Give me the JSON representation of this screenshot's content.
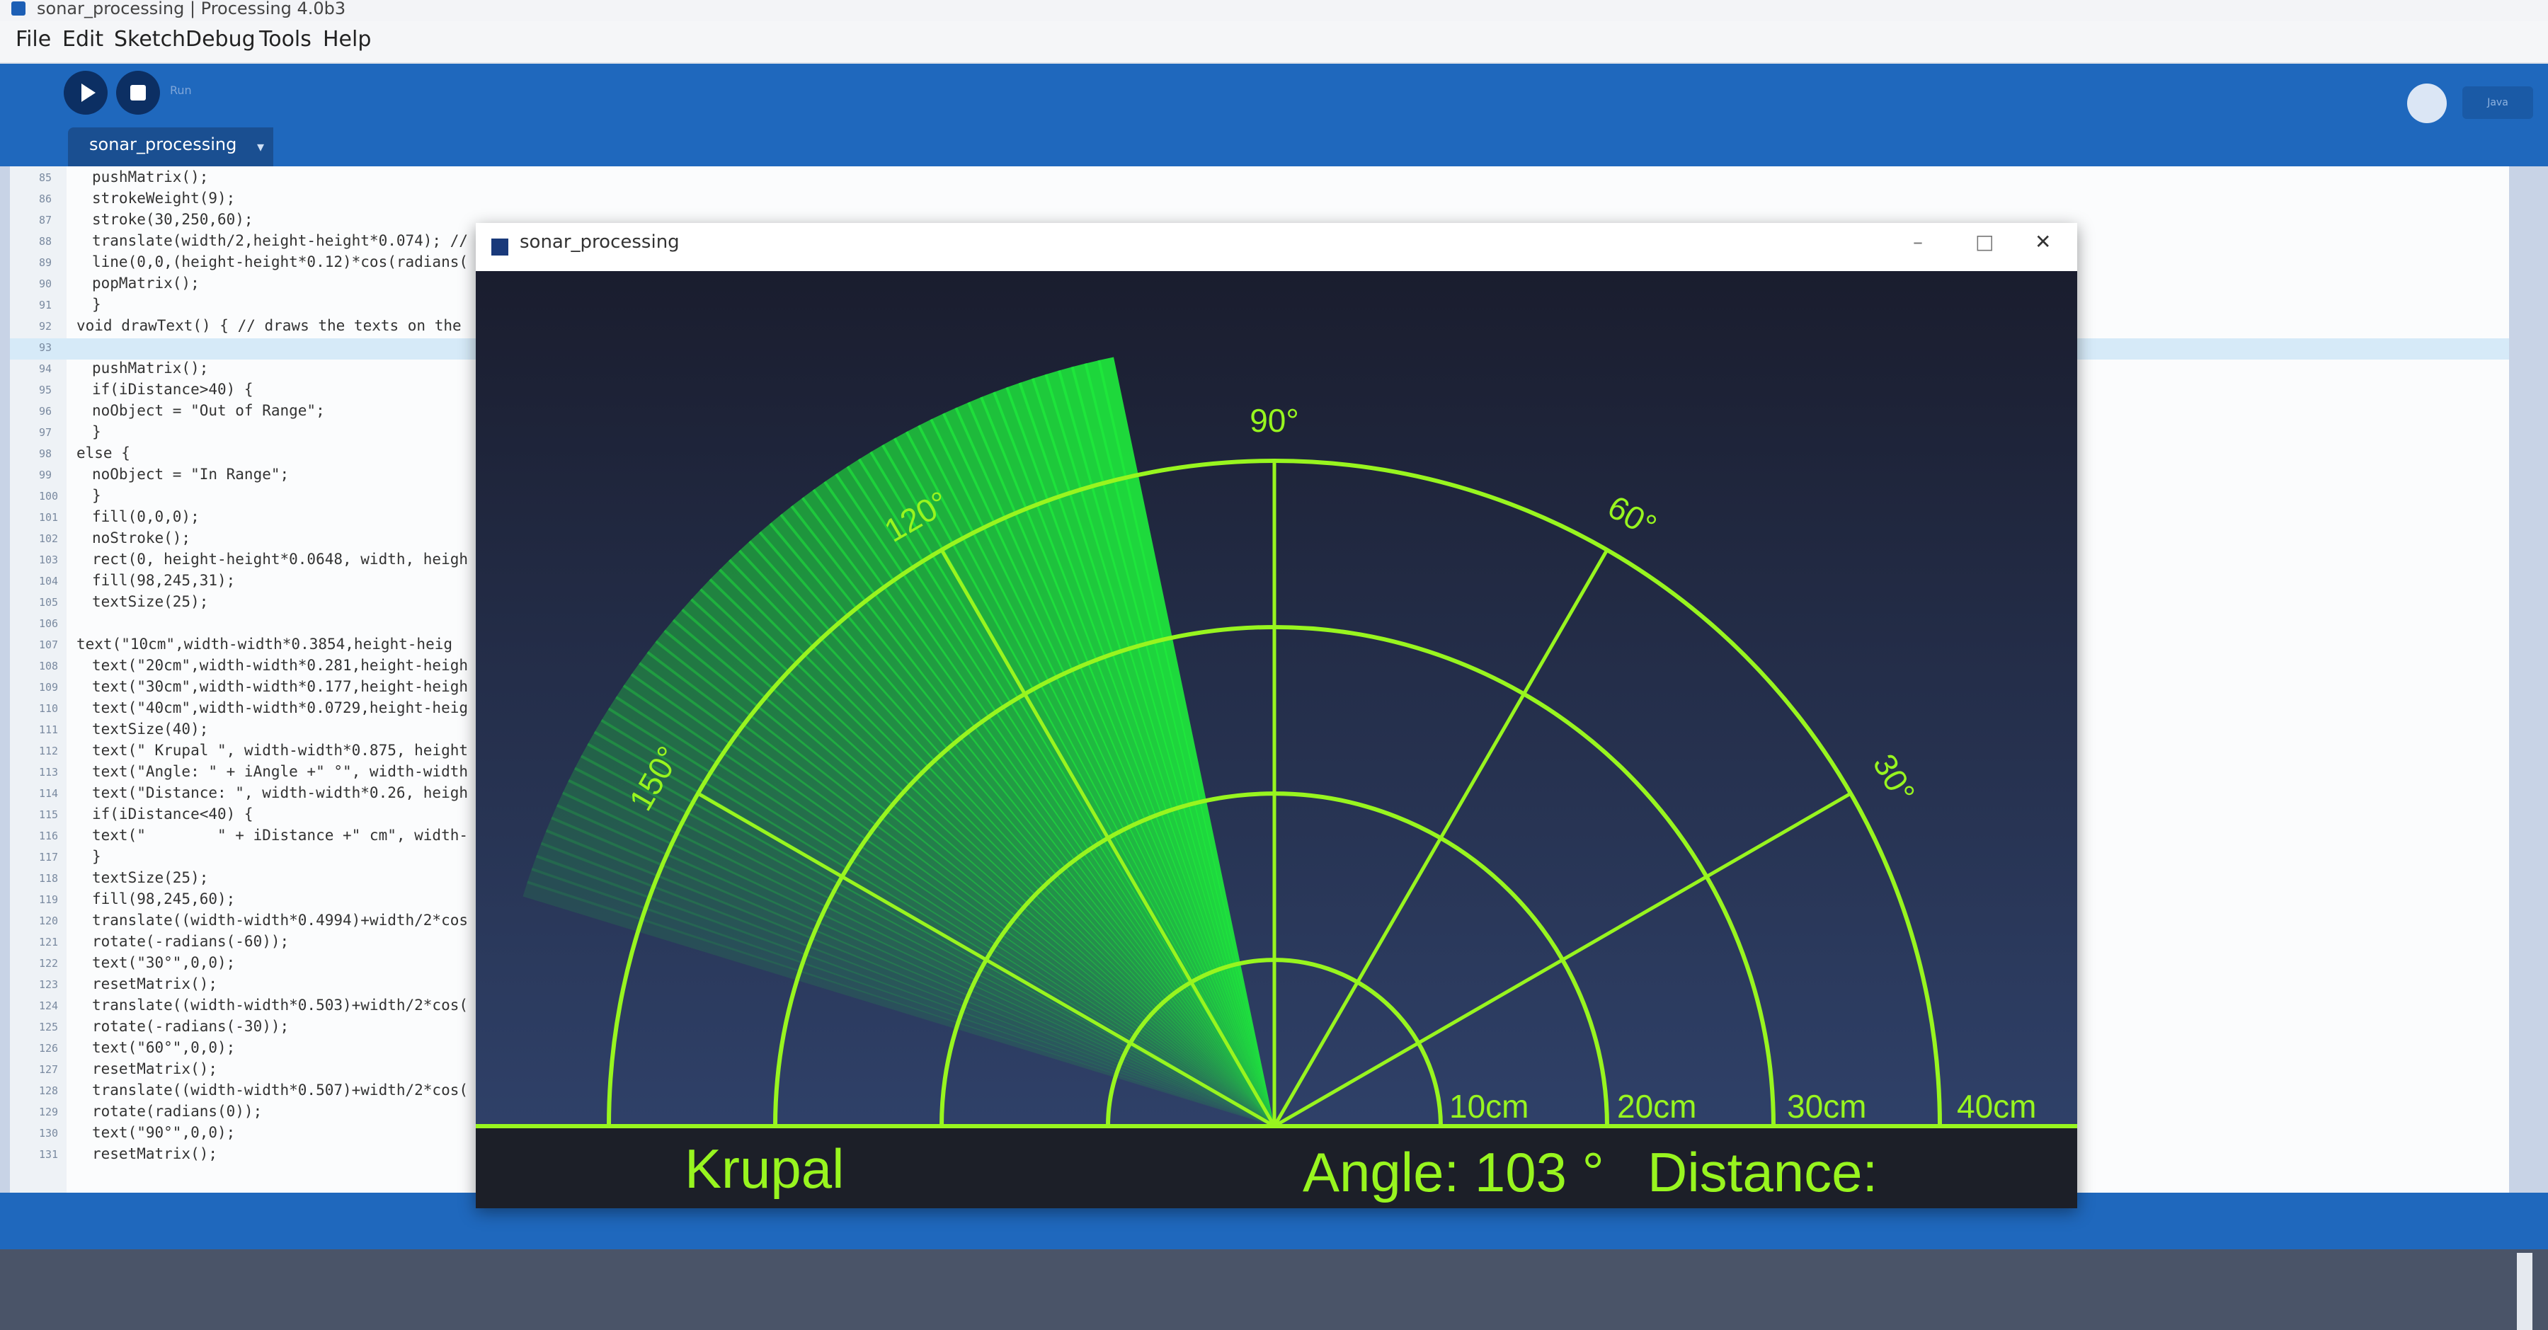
{
  "window": {
    "title": "sonar_processing | Processing 4.0b3"
  },
  "menu": {
    "items": [
      "File",
      "Edit",
      "Sketch",
      "Debug",
      "Tools",
      "Help"
    ]
  },
  "toolbar": {
    "run_tooltip": "Run",
    "mode_label": "Java"
  },
  "editor": {
    "tab_label": "sonar_processing",
    "lines": [
      {
        "n": "85",
        "code": "pushMatrix();"
      },
      {
        "n": "86",
        "code": "strokeWeight(9);"
      },
      {
        "n": "87",
        "code": "stroke(30,250,60);"
      },
      {
        "n": "88",
        "code": "translate(width/2,height-height*0.074); //"
      },
      {
        "n": "89",
        "code": "line(0,0,(height-height*0.12)*cos(radians("
      },
      {
        "n": "90",
        "code": "popMatrix();"
      },
      {
        "n": "91",
        "code": "}"
      },
      {
        "n": "92",
        "code": "void drawText() { // draws the texts on the"
      },
      {
        "n": "93",
        "code": ""
      },
      {
        "n": "94",
        "code": "pushMatrix();"
      },
      {
        "n": "95",
        "code": "if(iDistance>40) {"
      },
      {
        "n": "96",
        "code": "noObject = \"Out of Range\";"
      },
      {
        "n": "97",
        "code": "}"
      },
      {
        "n": "98",
        "code": "else {"
      },
      {
        "n": "99",
        "code": "noObject = \"In Range\";"
      },
      {
        "n": "100",
        "code": "}"
      },
      {
        "n": "101",
        "code": "fill(0,0,0);"
      },
      {
        "n": "102",
        "code": "noStroke();"
      },
      {
        "n": "103",
        "code": "rect(0, height-height*0.0648, width, heigh"
      },
      {
        "n": "104",
        "code": "fill(98,245,31);"
      },
      {
        "n": "105",
        "code": "textSize(25);"
      },
      {
        "n": "106",
        "code": ""
      },
      {
        "n": "107",
        "code": "text(\"10cm\",width-width*0.3854,height-heig"
      },
      {
        "n": "108",
        "code": "text(\"20cm\",width-width*0.281,height-heigh"
      },
      {
        "n": "109",
        "code": "text(\"30cm\",width-width*0.177,height-heigh"
      },
      {
        "n": "110",
        "code": "text(\"40cm\",width-width*0.0729,height-heig"
      },
      {
        "n": "111",
        "code": "textSize(40);"
      },
      {
        "n": "112",
        "code": "text(\" Krupal \", width-width*0.875, height"
      },
      {
        "n": "113",
        "code": "text(\"Angle: \" + iAngle +\" °\", width-width"
      },
      {
        "n": "114",
        "code": "text(\"Distance: \", width-width*0.26, heigh"
      },
      {
        "n": "115",
        "code": "if(iDistance<40) {"
      },
      {
        "n": "116",
        "code": "text(\"        \" + iDistance +\" cm\", width-"
      },
      {
        "n": "117",
        "code": "}"
      },
      {
        "n": "118",
        "code": "textSize(25);"
      },
      {
        "n": "119",
        "code": "fill(98,245,60);"
      },
      {
        "n": "120",
        "code": "translate((width-width*0.4994)+width/2*cos"
      },
      {
        "n": "121",
        "code": "rotate(-radians(-60));"
      },
      {
        "n": "122",
        "code": "text(\"30°\",0,0);"
      },
      {
        "n": "123",
        "code": "resetMatrix();"
      },
      {
        "n": "124",
        "code": "translate((width-width*0.503)+width/2*cos("
      },
      {
        "n": "125",
        "code": "rotate(-radians(-30));"
      },
      {
        "n": "126",
        "code": "text(\"60°\",0,0);"
      },
      {
        "n": "127",
        "code": "resetMatrix();"
      },
      {
        "n": "128",
        "code": "translate((width-width*0.507)+width/2*cos("
      },
      {
        "n": "129",
        "code": "rotate(radians(0));"
      },
      {
        "n": "130",
        "code": "text(\"90°\",0,0);"
      },
      {
        "n": "131",
        "code": "resetMatrix();"
      }
    ]
  },
  "sketch_window": {
    "title": "sonar_processing",
    "controls": {
      "minimize": "–",
      "maximize": "□",
      "close": "✕"
    }
  },
  "radar": {
    "angle_labels": [
      "30°",
      "60°",
      "90°",
      "120°",
      "150°"
    ],
    "range_labels": [
      "10cm",
      "20cm",
      "30cm",
      "40cm"
    ],
    "name_text": "Krupal",
    "angle_text": "Angle: 103 °",
    "distance_text": "Distance:",
    "current_angle_deg": 103,
    "colors": {
      "green": "#98f51f",
      "sweep": "#1ee83c",
      "background_top": "#1a1d2e",
      "background_bottom": "#31446e"
    }
  }
}
